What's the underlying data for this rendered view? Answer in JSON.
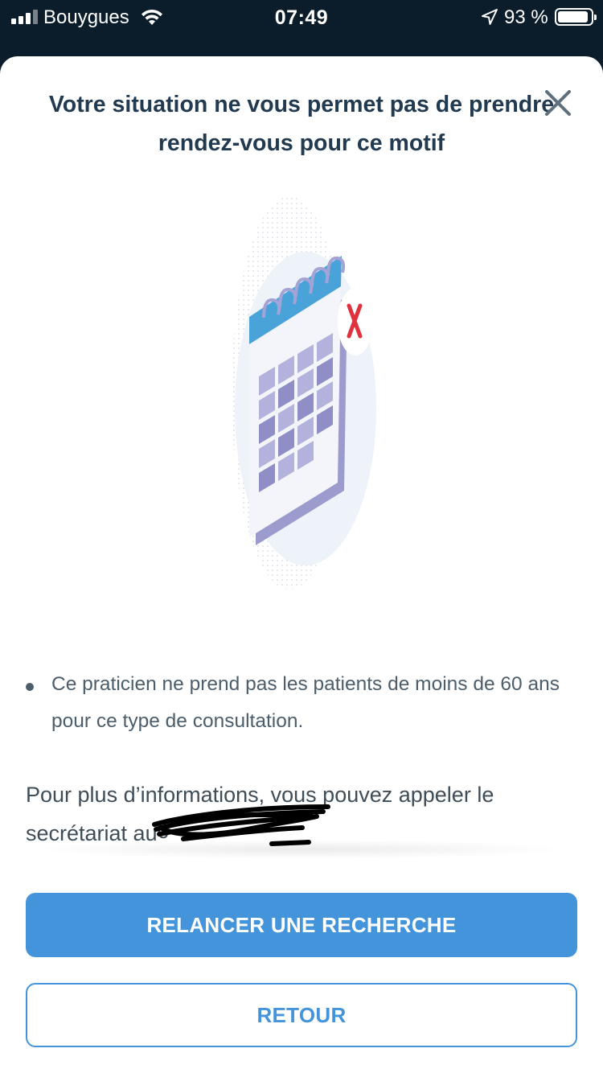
{
  "status_bar": {
    "carrier": "Bouygues",
    "time": "07:49",
    "battery_percent": "93 %",
    "battery_level": 0.93,
    "icons": [
      "signal-icon",
      "wifi-icon",
      "location-arrow-icon",
      "battery-icon"
    ]
  },
  "modal": {
    "title": "Votre situation ne vous permet pas de prendre rendez-vous pour ce motif",
    "close_icon": "close-icon",
    "illustration_icon": "calendar-unavailable-icon",
    "reasons": [
      {
        "text": "Ce praticien ne prend pas les patients de moins de 60 ans pour ce type de consultation."
      }
    ],
    "contact_text": "Pour plus d’informations, vous pouvez appeler le secrétariat au",
    "phone_visible": "0"
  },
  "actions": {
    "primary_label": "RELANCER UNE RECHERCHE",
    "secondary_label": "RETOUR"
  },
  "colors": {
    "accent": "#4394da",
    "title": "#213a4f",
    "text": "#4c5d6b",
    "calendar_header": "#4aa3d8",
    "calendar_cells": "#b3b2dd",
    "cancel_mark": "#e0313f"
  }
}
